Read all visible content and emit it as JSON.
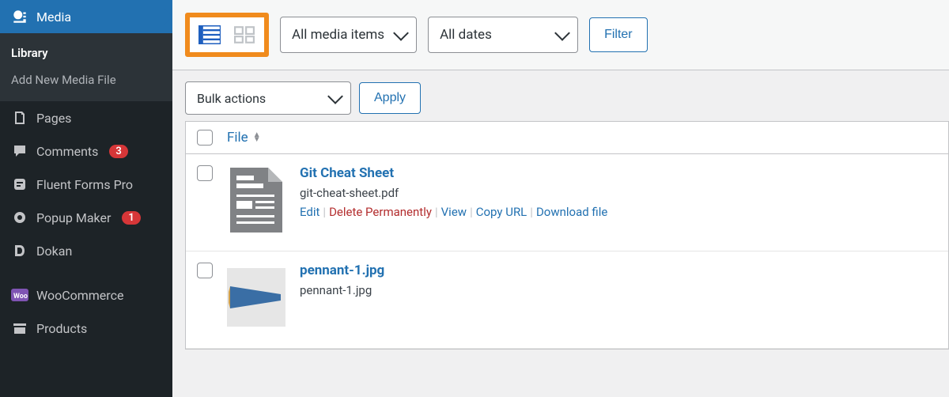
{
  "sidebar": {
    "media": {
      "label": "Media"
    },
    "library": {
      "label": "Library"
    },
    "add_new": {
      "label": "Add New Media File"
    },
    "pages": {
      "label": "Pages"
    },
    "comments": {
      "label": "Comments",
      "badge": "3"
    },
    "fluent": {
      "label": "Fluent Forms Pro"
    },
    "popup": {
      "label": "Popup Maker",
      "badge": "1"
    },
    "dokan": {
      "label": "Dokan"
    },
    "woo": {
      "label": "WooCommerce"
    },
    "products": {
      "label": "Products"
    }
  },
  "toolbar": {
    "type_filter": "All media items",
    "date_filter": "All dates",
    "filter_btn": "Filter",
    "bulk": "Bulk actions",
    "apply": "Apply"
  },
  "table": {
    "col_file": "File",
    "rows": [
      {
        "title": "Git Cheat Sheet",
        "filename": "git-cheat-sheet.pdf",
        "actions": {
          "edit": "Edit",
          "delete": "Delete Permanently",
          "view": "View",
          "copy": "Copy URL",
          "download": "Download file"
        }
      },
      {
        "title": "pennant-1.jpg",
        "filename": "pennant-1.jpg"
      }
    ]
  }
}
